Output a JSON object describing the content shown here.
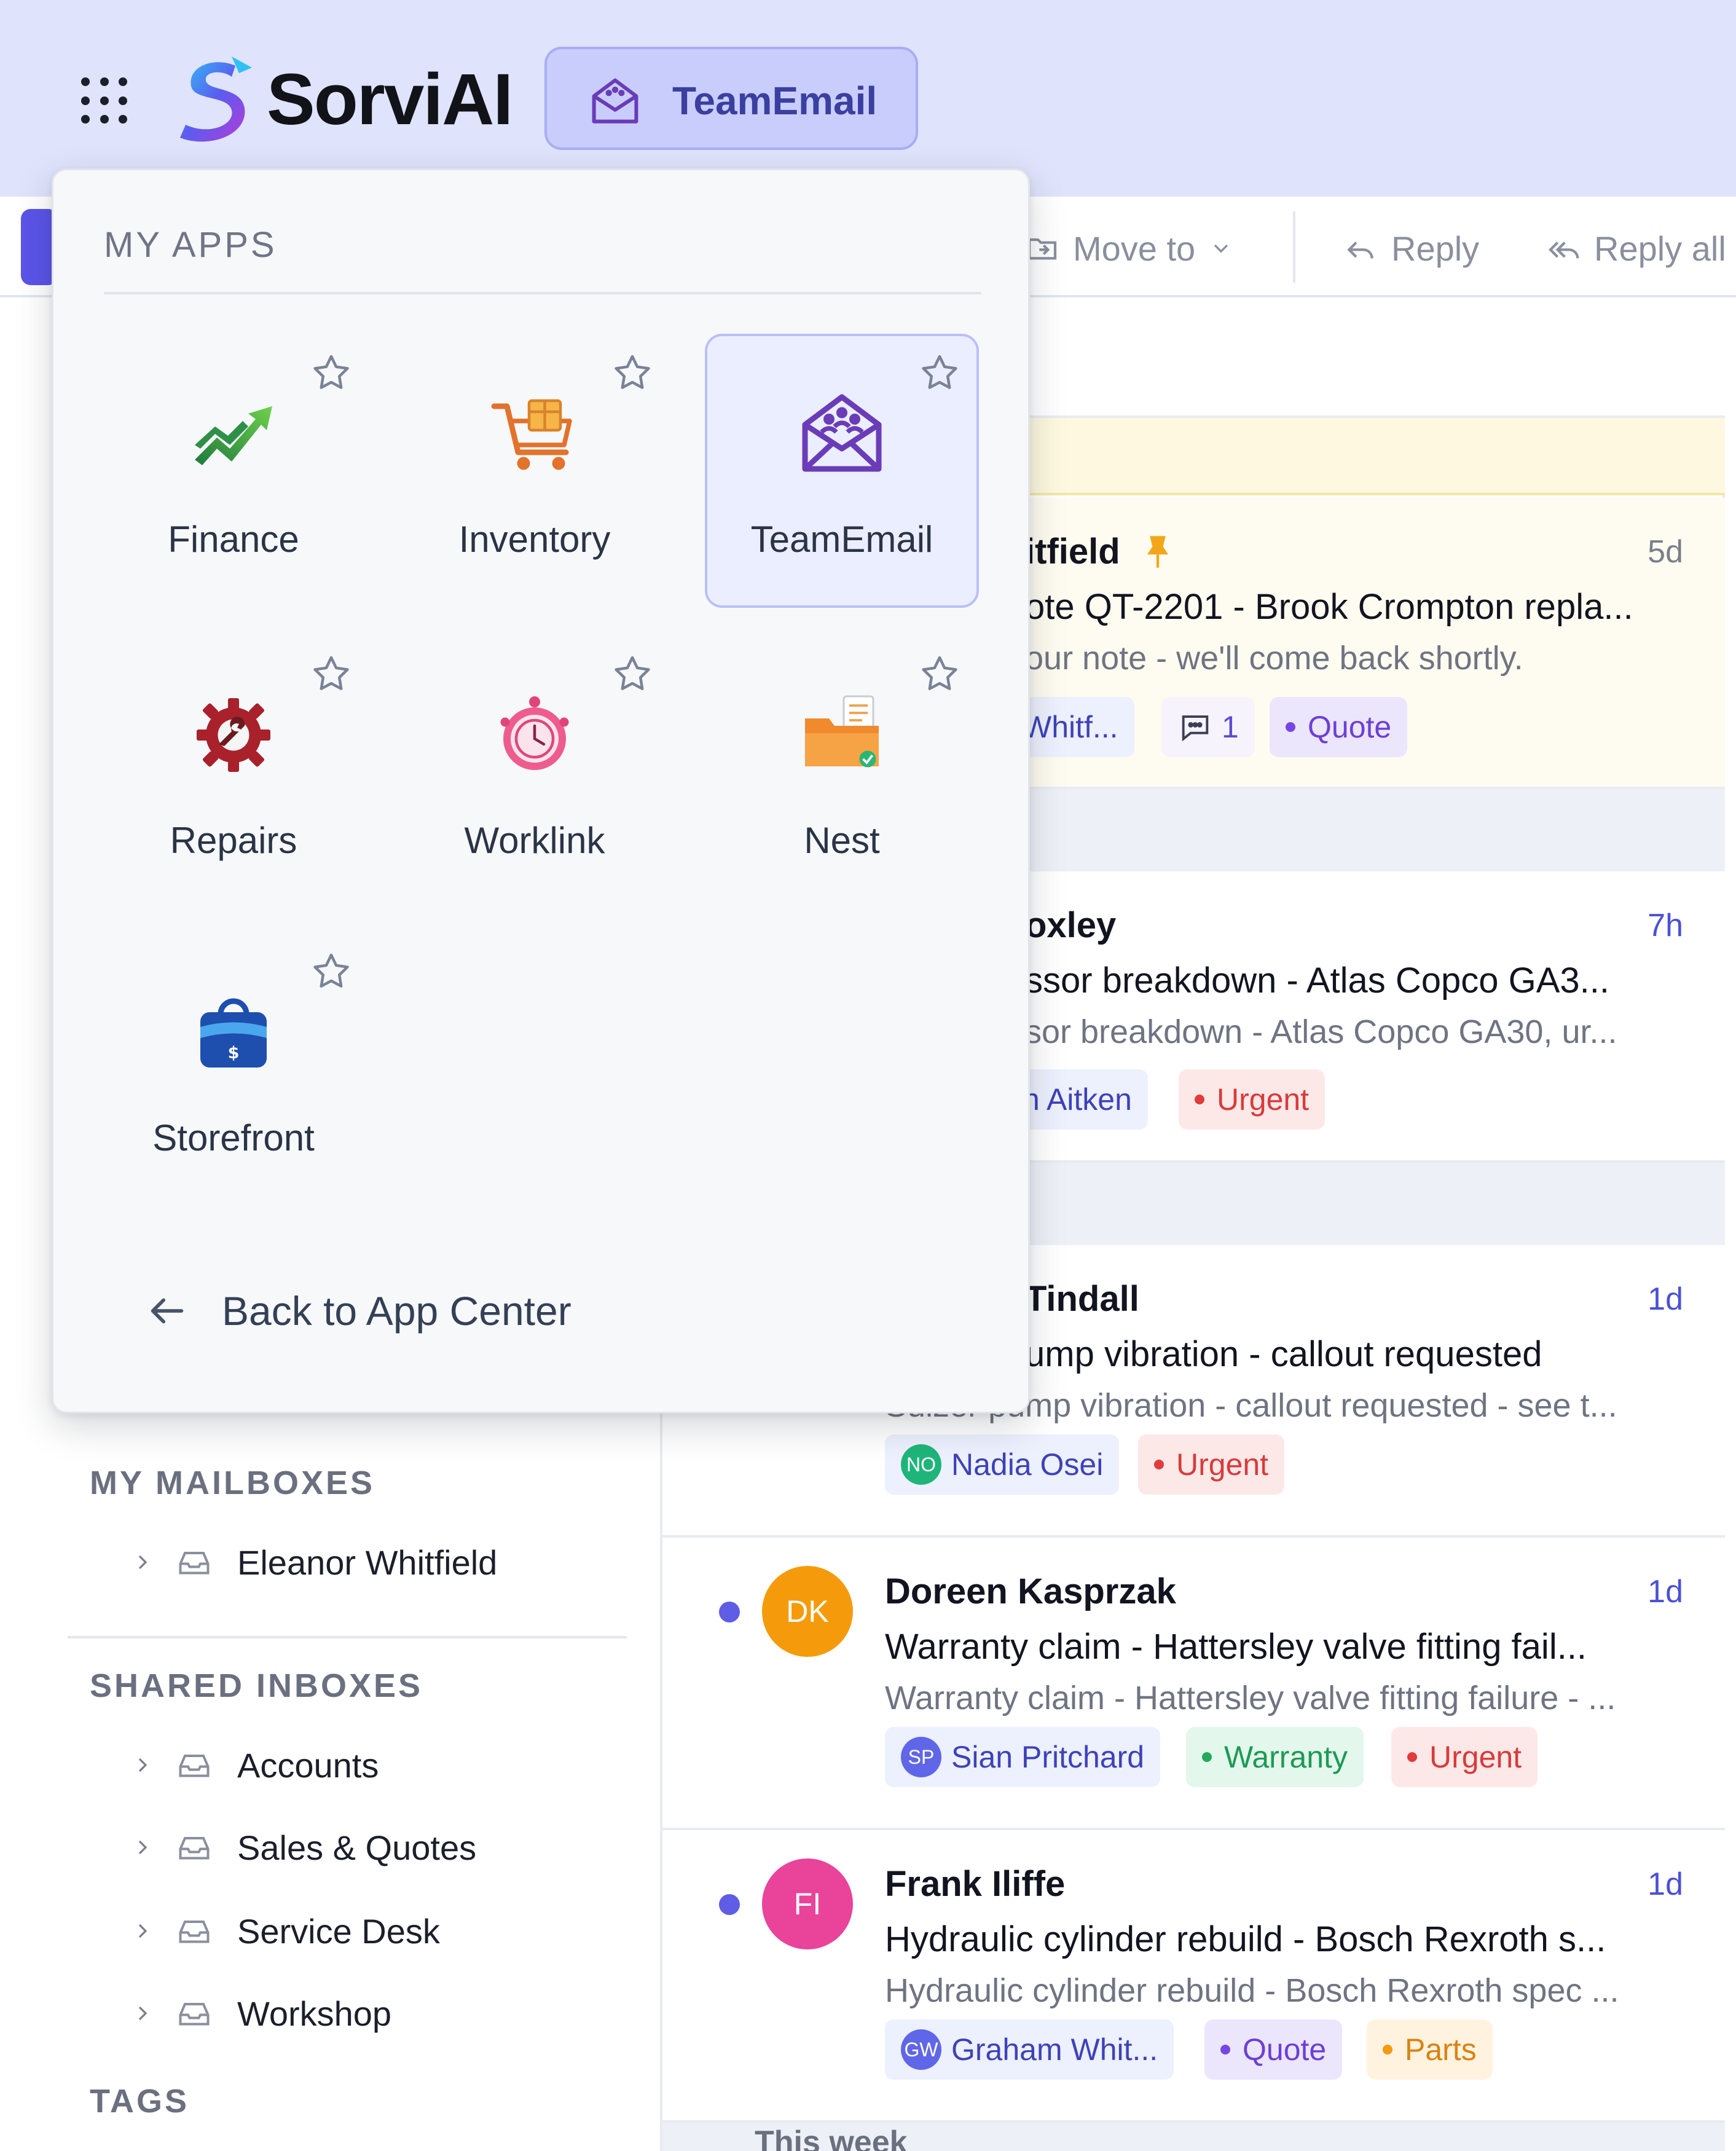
{
  "header": {
    "brand": "SorviAI",
    "current_app": "TeamEmail"
  },
  "toolbar": {
    "move_to": "Move to",
    "reply": "Reply",
    "reply_all": "Reply all"
  },
  "sidebar": {
    "my_mailboxes_title": "MY MAILBOXES",
    "my_mailboxes": [
      "Eleanor Whitfield"
    ],
    "shared_inboxes_title": "SHARED INBOXES",
    "shared_inboxes": [
      "Accounts",
      "Sales & Quotes",
      "Service Desk",
      "Workshop"
    ],
    "tags_title": "TAGS"
  },
  "mail": {
    "pinned": {
      "sender": "itfield",
      "time": "5d",
      "subject": "ote QT-2201 - Brook Crompton repla...",
      "preview": "our note - we'll come back shortly.",
      "tag_person": "Whitf...",
      "comments": "1",
      "tag_quote": "Quote"
    },
    "item2": {
      "sender": "oxley",
      "time": "7h",
      "subject": "ssor breakdown - Atlas Copco GA3...",
      "preview": "sor breakdown - Atlas Copco GA30, ur...",
      "tag_person": "n Aitken",
      "tag_urgent": "Urgent"
    },
    "item3": {
      "sender": "Tindall",
      "time": "1d",
      "subject": "ump vibration - callout requested",
      "preview": "Sulzer pump vibration - callout requested - see t...",
      "assignee_initials": "NO",
      "tag_person": "Nadia Osei",
      "tag_urgent": "Urgent"
    },
    "item4": {
      "initials": "DK",
      "sender": "Doreen Kasprzak",
      "time": "1d",
      "subject": "Warranty claim - Hattersley valve fitting fail...",
      "preview": "Warranty claim - Hattersley valve fitting failure - ...",
      "assignee_initials": "SP",
      "tag_person": "Sian Pritchard",
      "tag_warranty": "Warranty",
      "tag_urgent": "Urgent"
    },
    "item5": {
      "initials": "FI",
      "sender": "Frank Iliffe",
      "time": "1d",
      "subject": "Hydraulic cylinder rebuild - Bosch Rexroth s...",
      "preview": "Hydraulic cylinder rebuild - Bosch Rexroth spec ...",
      "assignee_initials": "GW",
      "tag_person": "Graham Whit...",
      "tag_quote": "Quote",
      "tag_parts": "Parts"
    },
    "group_this_week": "This week"
  },
  "dropdown": {
    "title": "MY APPS",
    "apps": [
      {
        "name": "Finance",
        "icon": "finance-chart-icon"
      },
      {
        "name": "Inventory",
        "icon": "inventory-cart-icon"
      },
      {
        "name": "TeamEmail",
        "icon": "team-email-icon"
      },
      {
        "name": "Repairs",
        "icon": "repairs-gear-icon"
      },
      {
        "name": "Worklink",
        "icon": "worklink-clock-icon"
      },
      {
        "name": "Nest",
        "icon": "nest-folder-icon"
      },
      {
        "name": "Storefront",
        "icon": "storefront-bag-icon"
      }
    ],
    "back_label": "Back to App Center"
  },
  "colors": {
    "accent": "#5b54e8",
    "header_bg": "#dfe3fb",
    "urgent": "#e03c3c",
    "warranty": "#22a95e",
    "quote": "#7646e4",
    "parts": "#f29a12"
  }
}
